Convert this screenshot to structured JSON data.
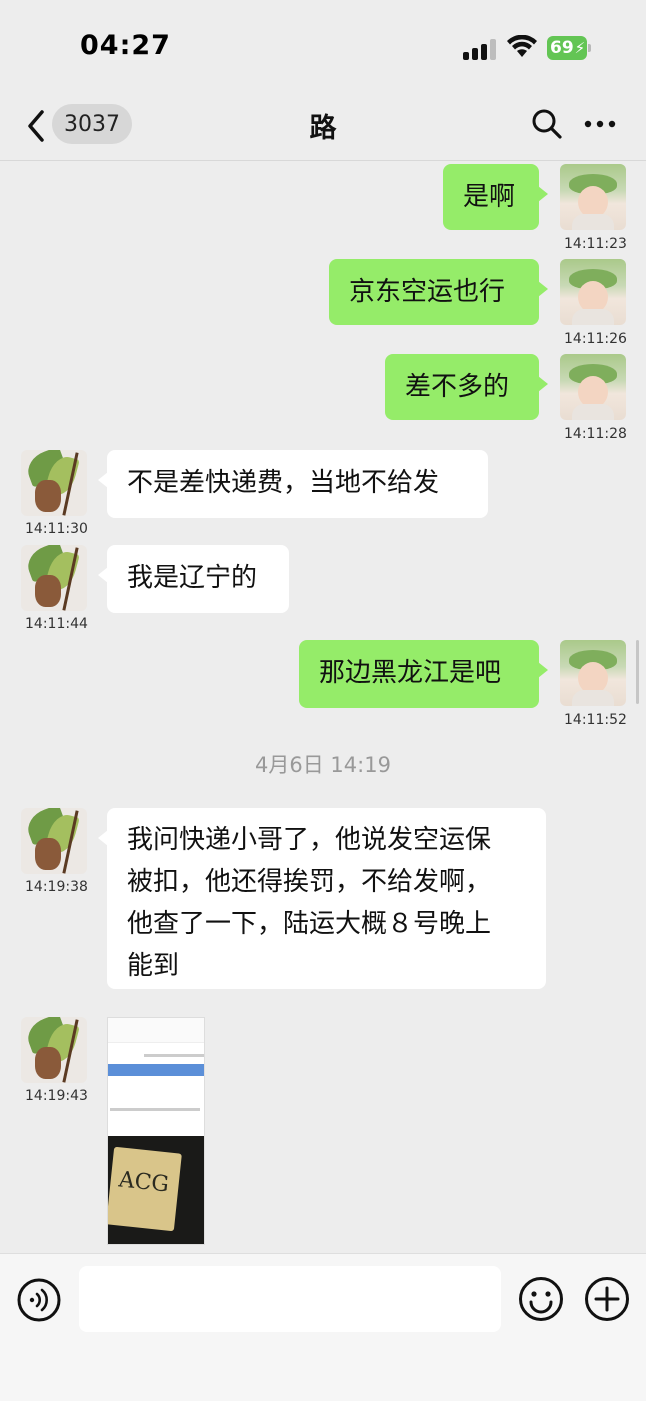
{
  "status_bar": {
    "time": "04:27",
    "battery": "69"
  },
  "nav": {
    "unread_count": "3037",
    "title": "路"
  },
  "messages": [
    {
      "side": "right",
      "text": "是啊",
      "time": "14:11:23"
    },
    {
      "side": "right",
      "text": "京东空运也行",
      "time": "14:11:26"
    },
    {
      "side": "right",
      "text": "差不多的",
      "time": "14:11:28"
    },
    {
      "side": "left",
      "text": "不是差快递费，当地不给发",
      "time": "14:11:30"
    },
    {
      "side": "left",
      "text": "我是辽宁的",
      "time": "14:11:44"
    },
    {
      "side": "right",
      "text": "那边黑龙江是吧",
      "time": "14:11:52"
    },
    {
      "side": "left",
      "text_lines": [
        "我问快递小哥了，他说发空运保",
        "被扣，他还得挨罚，不给发啊，",
        "他查了一下，陆运大概８号晚上",
        "能到"
      ],
      "time": "14:19:38"
    },
    {
      "side": "left",
      "type": "image",
      "time": "14:19:43",
      "image_label_text": "ACG"
    }
  ],
  "date_separator": "4月6日 14:19",
  "input": {
    "placeholder": ""
  }
}
